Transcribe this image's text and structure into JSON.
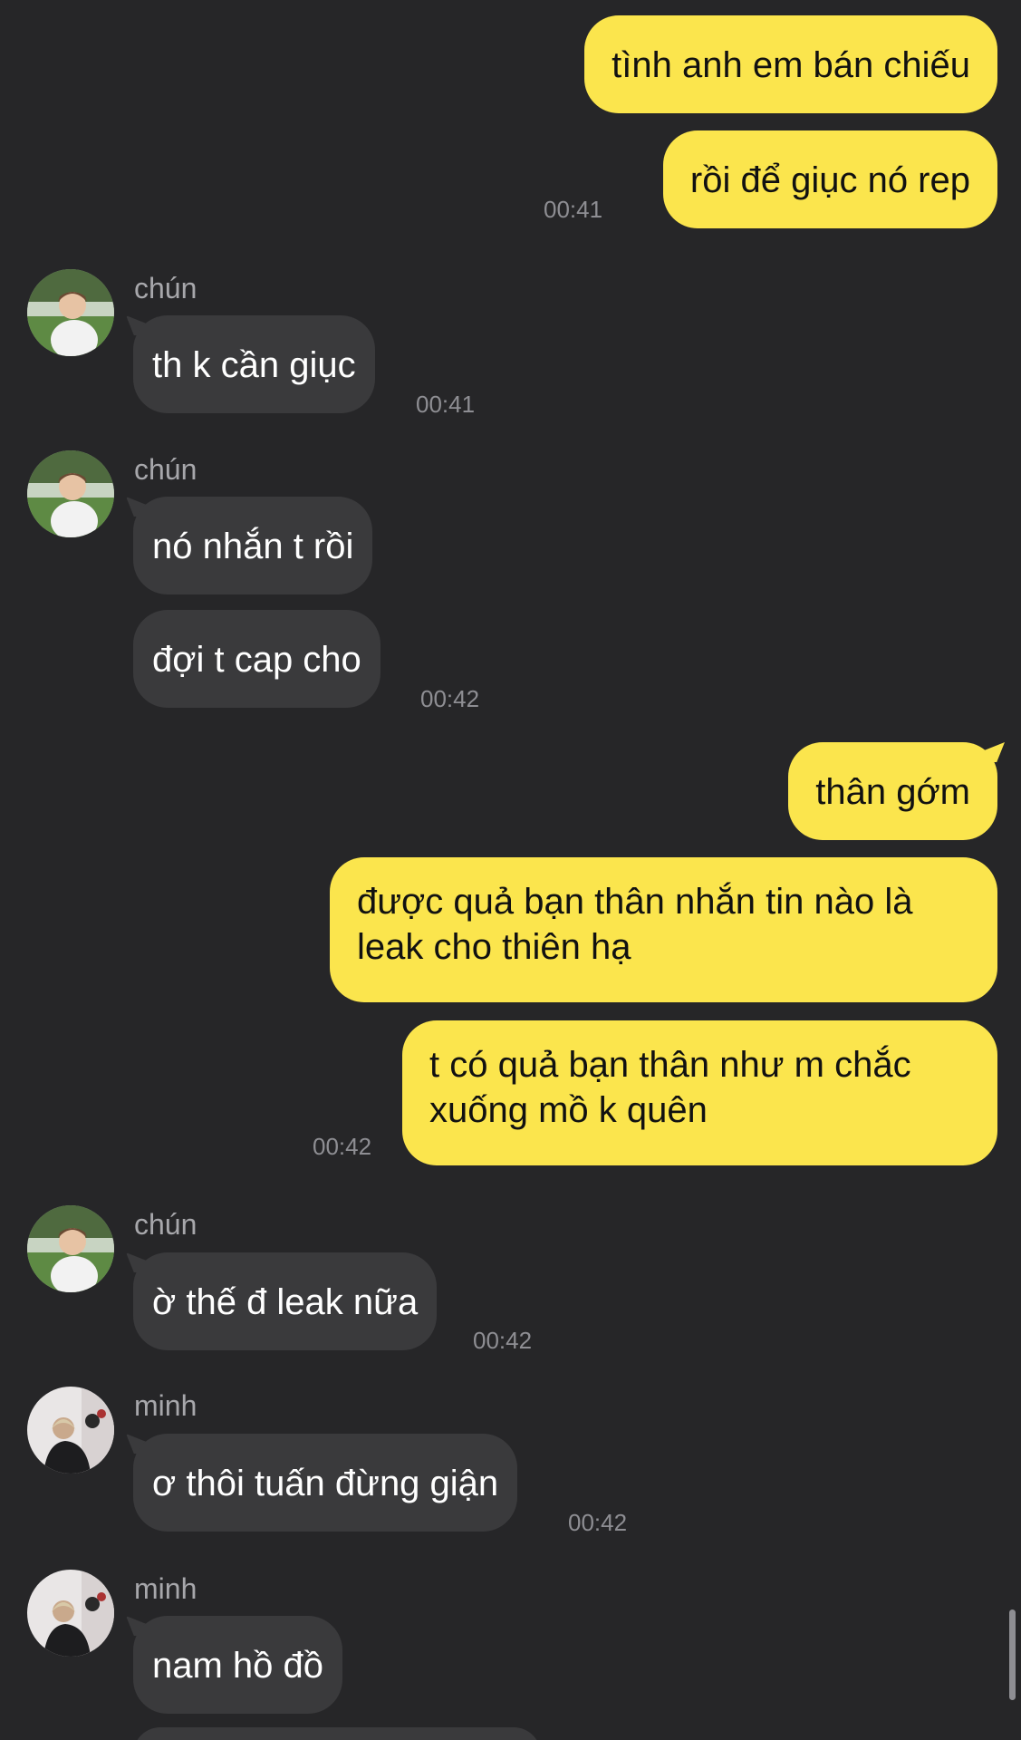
{
  "messages": {
    "m1": "tình anh em bán chiếu",
    "m2": "rồi để giục nó rep",
    "m3": "th k cần giục",
    "m4": "nó nhắn t rồi",
    "m5": "đợi t cap cho",
    "m6": "thân gớm",
    "m7": "được quả bạn thân nhắn tin nào là\nleak cho thiên hạ",
    "m8": "t có quả bạn thân như m chắc\nxuống mồ k quên",
    "m9": "ờ thế đ leak nữa",
    "m10": "ơ thôi tuấn đừng giận",
    "m11": "nam hồ đồ"
  },
  "times": {
    "t1": "00:41",
    "t2": "00:41",
    "t3": "00:42",
    "t4": "00:42",
    "t5": "00:42",
    "t6": "00:42"
  },
  "senders": {
    "s1": "chún",
    "s2": "chún",
    "s3": "chún",
    "s4": "minh",
    "s5": "minh"
  },
  "colors": {
    "background": "#262628",
    "incoming_bubble": "#3a3a3c",
    "outgoing_bubble": "#fbe54d",
    "timestamp": "#8e8e93"
  }
}
